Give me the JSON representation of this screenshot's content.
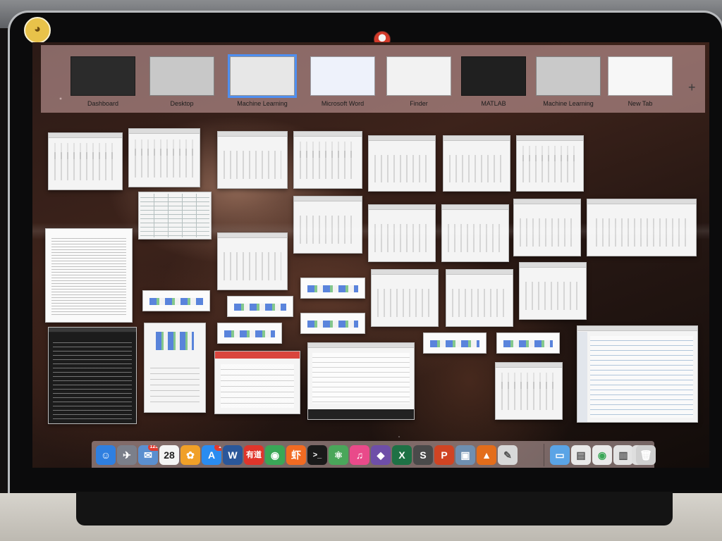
{
  "spaces": {
    "items": [
      {
        "label": "Dashboard",
        "thumb": "#2b2b2b"
      },
      {
        "label": "Desktop",
        "thumb": "#c8c8c8"
      },
      {
        "label": "Machine Learning",
        "thumb": "#e7e7e7",
        "active": true
      },
      {
        "label": "Microsoft Word",
        "thumb": "#eef2fb"
      },
      {
        "label": "Finder",
        "thumb": "#f2f2f2"
      },
      {
        "label": "MATLAB",
        "thumb": "#202020"
      },
      {
        "label": "Machine Learning",
        "thumb": "#c9c9c9"
      },
      {
        "label": "New Tab",
        "thumb": "#f7f7f7"
      }
    ],
    "add_label": "+"
  },
  "dock": {
    "items": [
      {
        "name": "finder-icon",
        "glyph": "☺",
        "color": "#2f7fe0"
      },
      {
        "name": "launchpad-icon",
        "glyph": "✈",
        "color": "#7b7f8a"
      },
      {
        "name": "mail-icon",
        "glyph": "✉",
        "color": "#5b8fcf",
        "badge": "1238"
      },
      {
        "name": "calendar-icon",
        "glyph": "28",
        "color": "#f4f4f4"
      },
      {
        "name": "photos-icon",
        "glyph": "✿",
        "color": "#f0a028"
      },
      {
        "name": "app-store-icon",
        "glyph": "A",
        "color": "#2a8cf0",
        "badge": "1"
      },
      {
        "name": "word-icon",
        "glyph": "W",
        "color": "#2b579a"
      },
      {
        "name": "youdao-icon",
        "glyph": "有道",
        "color": "#e0352b"
      },
      {
        "name": "chrome-icon",
        "glyph": "◉",
        "color": "#3aa757"
      },
      {
        "name": "xiami-icon",
        "glyph": "虾",
        "color": "#f26b22"
      },
      {
        "name": "terminal-icon",
        "glyph": ">_",
        "color": "#1a1a1a"
      },
      {
        "name": "atom-icon",
        "glyph": "⚛",
        "color": "#4aa65a"
      },
      {
        "name": "itunes-icon",
        "glyph": "♫",
        "color": "#e94a8a"
      },
      {
        "name": "github-icon",
        "glyph": "◆",
        "color": "#6e4ea8"
      },
      {
        "name": "excel-icon",
        "glyph": "X",
        "color": "#1e7145"
      },
      {
        "name": "sublime-icon",
        "glyph": "S",
        "color": "#4a4a4a"
      },
      {
        "name": "powerpoint-icon",
        "glyph": "P",
        "color": "#d04423"
      },
      {
        "name": "preview-icon",
        "glyph": "▣",
        "color": "#6f8fb0"
      },
      {
        "name": "matlab-icon",
        "glyph": "▲",
        "color": "#e36d1b"
      },
      {
        "name": "textedit-icon",
        "glyph": "✎",
        "color": "#d8d8d8"
      },
      {
        "name": "downloads-folder-icon",
        "glyph": "▭",
        "color": "#5aa4e6"
      },
      {
        "name": "document-stack-icon",
        "glyph": "▤",
        "color": "#e9e9e9"
      },
      {
        "name": "chrome-stack-icon",
        "glyph": "◉",
        "color": "#eaeaea"
      },
      {
        "name": "screenshot-stack-icon",
        "glyph": "▥",
        "color": "#e3e3e3"
      },
      {
        "name": "window-stack-icon",
        "glyph": "▦",
        "color": "#dedede"
      },
      {
        "name": "trash-icon",
        "glyph": "🗑",
        "color": "#cfcfcf"
      }
    ]
  }
}
